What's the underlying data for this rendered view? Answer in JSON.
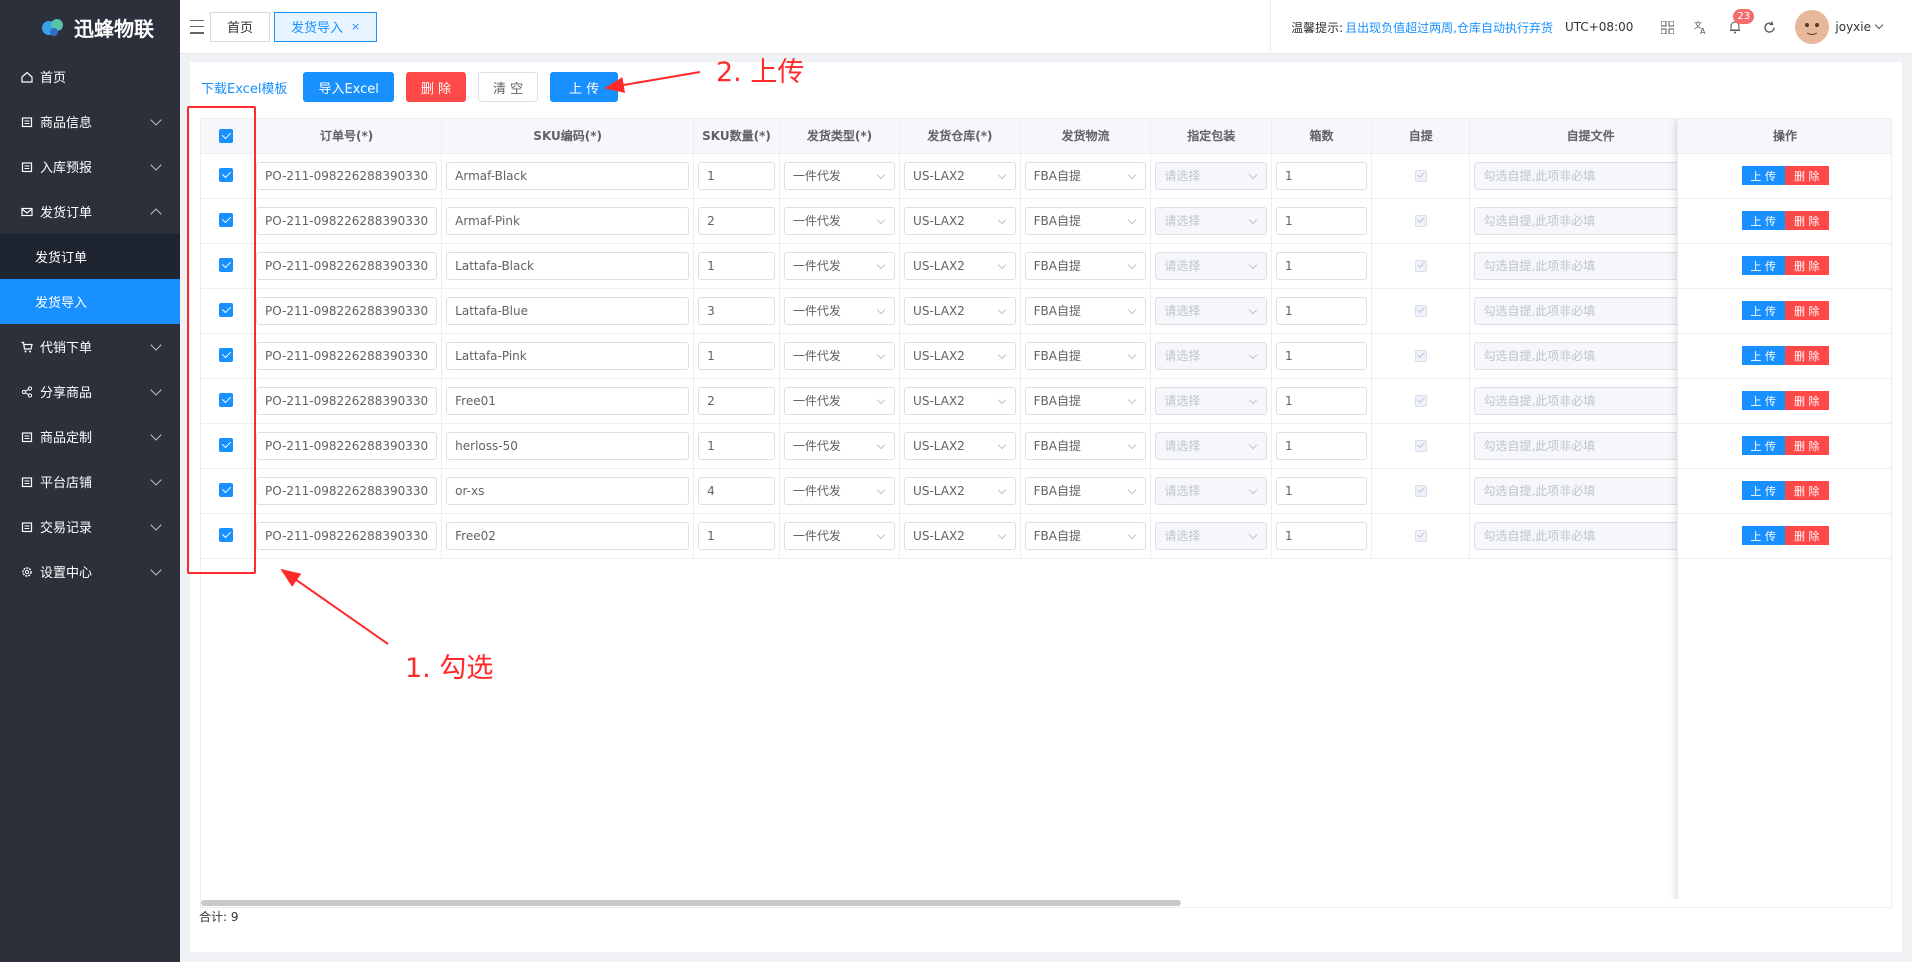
{
  "app": {
    "name": "迅蜂物联"
  },
  "sidebar": {
    "items": [
      {
        "label": "首页",
        "icon": "home-icon",
        "expandable": false
      },
      {
        "label": "商品信息",
        "icon": "goods-icon",
        "expandable": true
      },
      {
        "label": "入库预报",
        "icon": "inbound-icon",
        "expandable": true
      },
      {
        "label": "发货订单",
        "icon": "mail-icon",
        "expandable": true,
        "open": true
      },
      {
        "label": "代销下单",
        "icon": "cart-icon",
        "expandable": true
      },
      {
        "label": "分享商品",
        "icon": "share-icon",
        "expandable": true
      },
      {
        "label": "商品定制",
        "icon": "custom-icon",
        "expandable": true
      },
      {
        "label": "平台店铺",
        "icon": "store-icon",
        "expandable": true
      },
      {
        "label": "交易记录",
        "icon": "record-icon",
        "expandable": true
      },
      {
        "label": "设置中心",
        "icon": "gear-icon",
        "expandable": true
      }
    ],
    "subitems": [
      {
        "label": "发货订单",
        "active": false
      },
      {
        "label": "发货导入",
        "active": true
      }
    ]
  },
  "tabs": [
    {
      "label": "首页",
      "active": false
    },
    {
      "label": "发货导入",
      "active": true,
      "close": "×"
    }
  ],
  "header": {
    "notice_label": "温馨提示:",
    "notice_text": "且出现负值超过两周,仓库自动执行弃货",
    "timezone": "UTC+08:00",
    "badge_count": "23",
    "username": "joyxie"
  },
  "toolbar": {
    "download_label": "下载Excel模板",
    "import_label": "导入Excel",
    "delete_label": "删 除",
    "clear_label": "清 空",
    "upload_label": "上 传"
  },
  "table": {
    "headers": [
      "订单号(*)",
      "SKU编码(*)",
      "SKU数量(*)",
      "发货类型(*)",
      "发货仓库(*)",
      "发货物流",
      "指定包装",
      "箱数",
      "自提",
      "自提文件",
      "操作"
    ],
    "rows": [
      {
        "order": "PO-211-098226288390330",
        "sku": "Armaf-Black",
        "qty": "1",
        "type": "一件代发",
        "warehouse": "US-LAX2",
        "logistics": "FBA自提",
        "pack": "请选择",
        "boxes": "1",
        "file": "勾选自提,此项非必填"
      },
      {
        "order": "PO-211-098226288390330",
        "sku": "Armaf-Pink",
        "qty": "2",
        "type": "一件代发",
        "warehouse": "US-LAX2",
        "logistics": "FBA自提",
        "pack": "请选择",
        "boxes": "1",
        "file": "勾选自提,此项非必填"
      },
      {
        "order": "PO-211-098226288390330",
        "sku": "Lattafa-Black",
        "qty": "1",
        "type": "一件代发",
        "warehouse": "US-LAX2",
        "logistics": "FBA自提",
        "pack": "请选择",
        "boxes": "1",
        "file": "勾选自提,此项非必填"
      },
      {
        "order": "PO-211-098226288390330",
        "sku": "Lattafa-Blue",
        "qty": "3",
        "type": "一件代发",
        "warehouse": "US-LAX2",
        "logistics": "FBA自提",
        "pack": "请选择",
        "boxes": "1",
        "file": "勾选自提,此项非必填"
      },
      {
        "order": "PO-211-098226288390330",
        "sku": "Lattafa-Pink",
        "qty": "1",
        "type": "一件代发",
        "warehouse": "US-LAX2",
        "logistics": "FBA自提",
        "pack": "请选择",
        "boxes": "1",
        "file": "勾选自提,此项非必填"
      },
      {
        "order": "PO-211-098226288390330",
        "sku": "Free01",
        "qty": "2",
        "type": "一件代发",
        "warehouse": "US-LAX2",
        "logistics": "FBA自提",
        "pack": "请选择",
        "boxes": "1",
        "file": "勾选自提,此项非必填"
      },
      {
        "order": "PO-211-098226288390330",
        "sku": "herloss-50",
        "qty": "1",
        "type": "一件代发",
        "warehouse": "US-LAX2",
        "logistics": "FBA自提",
        "pack": "请选择",
        "boxes": "1",
        "file": "勾选自提,此项非必填"
      },
      {
        "order": "PO-211-098226288390330",
        "sku": "or-xs",
        "qty": "4",
        "type": "一件代发",
        "warehouse": "US-LAX2",
        "logistics": "FBA自提",
        "pack": "请选择",
        "boxes": "1",
        "file": "勾选自提,此项非必填"
      },
      {
        "order": "PO-211-098226288390330",
        "sku": "Free02",
        "qty": "1",
        "type": "一件代发",
        "warehouse": "US-LAX2",
        "logistics": "FBA自提",
        "pack": "请选择",
        "boxes": "1",
        "file": "勾选自提,此项非必填"
      }
    ],
    "row_upload": "上 传",
    "row_delete": "删 除"
  },
  "footer": {
    "total": "合计: 9"
  },
  "annotations": {
    "step1": "1. 勾选",
    "step2": "2. 上传",
    "color": "#ff2b2b"
  },
  "colors": {
    "primary": "#1890ff",
    "danger": "#ff4949",
    "sidebar": "#2b303b"
  }
}
